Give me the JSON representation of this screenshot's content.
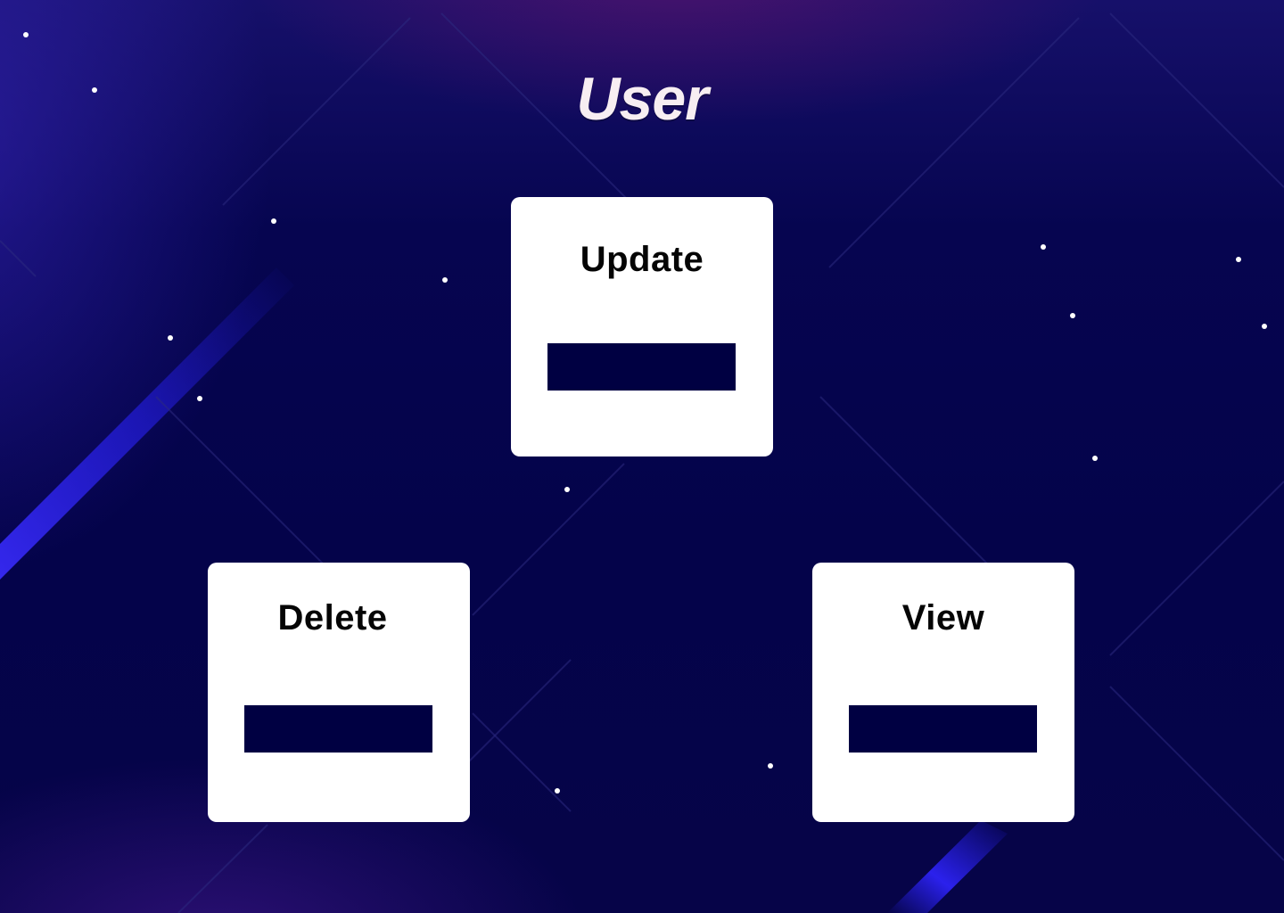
{
  "page": {
    "title": "User"
  },
  "cards": {
    "update": {
      "label": "Update"
    },
    "delete": {
      "label": "Delete"
    },
    "view": {
      "label": "View"
    }
  },
  "colors": {
    "background": "#04034a",
    "card": "#ffffff",
    "card_bar": "#000042",
    "title": "#f7eef2",
    "accent_glow": "#2a22ff",
    "star": "#ffffff"
  }
}
